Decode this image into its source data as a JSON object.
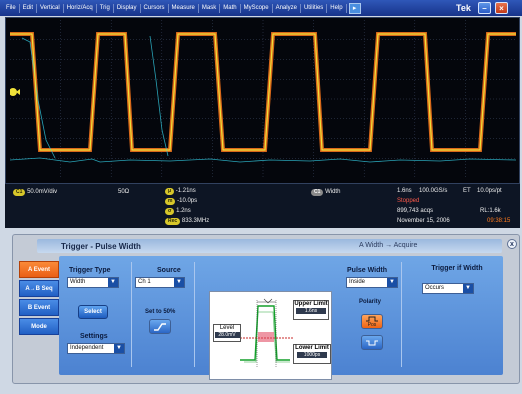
{
  "menu": {
    "items": [
      "File",
      "Edit",
      "Vertical",
      "Horiz/Acq",
      "Trig",
      "Display",
      "Cursors",
      "Measure",
      "Mask",
      "Math",
      "MyScope",
      "Analyze",
      "Utilities",
      "Help"
    ],
    "brand": "Tek",
    "help_arrow": "▸"
  },
  "status": {
    "ch1_badge": "C1",
    "ch1_scale": "50.0mV/div",
    "ch1_impedance": "50Ω",
    "measurements": [
      {
        "badge": "μ",
        "value": "-1.21ns"
      },
      {
        "badge": "m",
        "value": "-10.0ps"
      },
      {
        "badge": "σ",
        "value": "1.2ns"
      },
      {
        "badge": "Rec",
        "value": "833.3MHz"
      }
    ],
    "trig_badge": "C1",
    "trig_mode": "Width",
    "timebase": "1.6ns",
    "sample_rate": "100.0GS/s",
    "et": "ET",
    "resolution": "10.0ps/pt",
    "state": "Stopped",
    "acqs": "899,743 acqs",
    "record_length": "RL:1.6k",
    "date": "November 15, 2006",
    "time": "09:38:15"
  },
  "panel": {
    "title": "Trigger - Pulse Width",
    "status": "A Width → Acquire",
    "close": "x",
    "tabs": [
      "A Event",
      "A→B Seq",
      "B Event",
      "Mode"
    ],
    "trigger_type_label": "Trigger Type",
    "trigger_type_value": "Width",
    "select_button": "Select",
    "settings_label": "Settings",
    "settings_value": "Independent",
    "source_label": "Source",
    "source_value": "Ch 1",
    "set50_label": "Set to 50%",
    "diagram": {
      "upper_limit_label": "Upper Limit",
      "upper_limit_value": "1.6ns",
      "level_label": "Level",
      "level_value": "28.0mV",
      "lower_limit_label": "Lower Limit",
      "lower_limit_value": "1000ps"
    },
    "pulse_width_label": "Pulse Width",
    "pulse_width_value": "Inside",
    "polarity_label": "Polarity",
    "polarity_pos_sub": "Pos",
    "trigger_if_label": "Trigger if Width",
    "trigger_if_value": "Occurs"
  },
  "colors": {
    "ch1_trace": "#f0e23a",
    "persistence": "#ff7a1c",
    "secondary_trace": "#2db5c9",
    "stopped_text": "#ff5a4a",
    "time_text": "#ff7a1c"
  }
}
